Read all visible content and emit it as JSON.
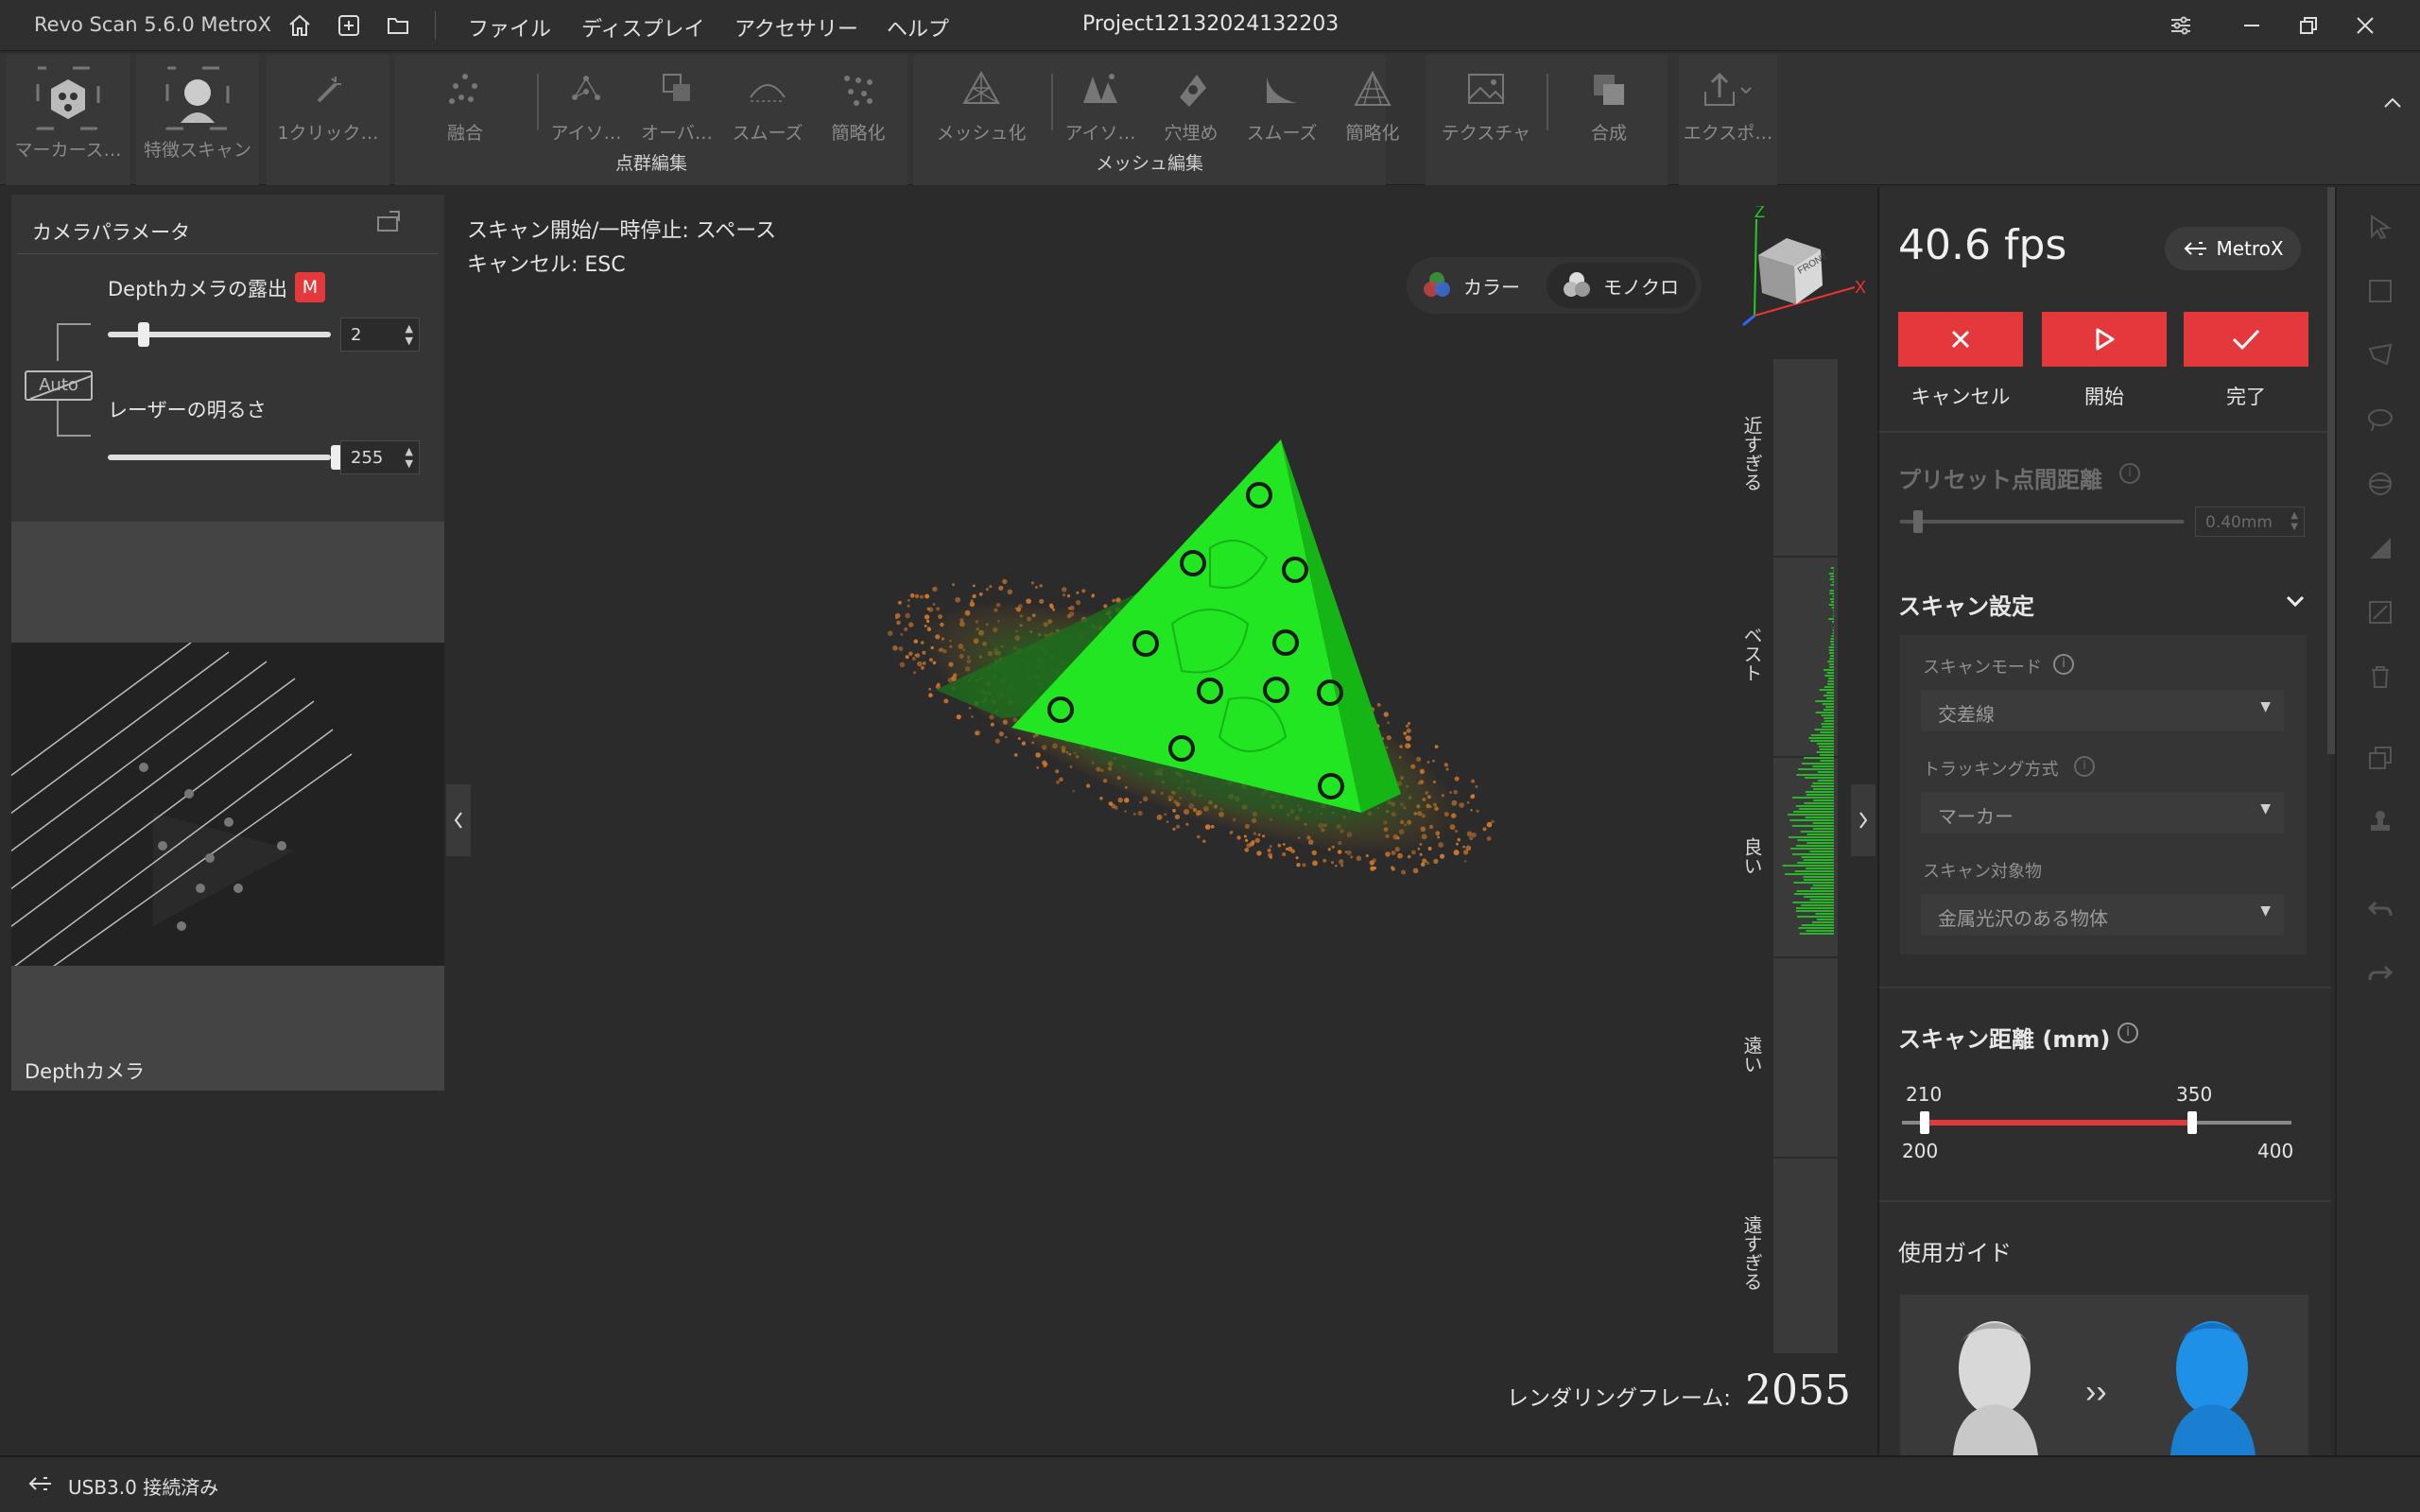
{
  "app": {
    "title": "Revo Scan 5.6.0 MetroX",
    "project": "Project12132024132203"
  },
  "menu": [
    "ファイル",
    "ディスプレイ",
    "アクセサリー",
    "ヘルプ"
  ],
  "toolbar": {
    "tools": [
      "マーカース…",
      "特徴スキャン",
      "1クリック…",
      "融合",
      "アイソ…",
      "オーバ…",
      "スムーズ",
      "簡略化",
      "メッシュ化",
      "アイソ…",
      "穴埋め",
      "スムーズ",
      "簡略化",
      "テクスチャ",
      "合成",
      "エクスポ…"
    ],
    "groups": {
      "point_cloud": "点群編集",
      "mesh": "メッシュ編集"
    }
  },
  "left_panel": {
    "title": "カメラパラメータ",
    "depth_exposure_label": "Depthカメラの露出",
    "mode_badge": "M",
    "depth_exposure_value": "2",
    "depth_exposure_level": 0.09,
    "auto_label": "Auto",
    "laser_label": "レーザーの明るさ",
    "laser_value": "255",
    "laser_level": 1.0,
    "camera_label": "Depthカメラ"
  },
  "viewport": {
    "hint_start": "スキャン開始/一時停止:  スペース",
    "hint_cancel": "キャンセル:  ESC",
    "color_mode": "カラー",
    "mono_mode": "モノクロ",
    "axis_z": "Z",
    "axis_x": "X",
    "cube_face": "FRONT",
    "quality_labels": [
      "近すぎる",
      "ベスト",
      "良い",
      "遠い",
      "遠すぎる"
    ],
    "render_label": "レンダリングフレーム:",
    "render_value": "2055"
  },
  "right_panel": {
    "fps": "40.6 fps",
    "device": "MetroX",
    "cancel": "キャンセル",
    "start": "開始",
    "done": "完了",
    "preset_label": "プリセット点間距離",
    "preset_value": "0.40mm",
    "scan_settings": "スキャン設定",
    "scan_mode_label": "スキャンモード",
    "scan_mode_value": "交差線",
    "tracking_label": "トラッキング方式",
    "tracking_value": "マーカー",
    "target_label": "スキャン対象物",
    "target_value": "金属光沢のある物体",
    "distance_title": "スキャン距離 (mm)",
    "distance_low": "210",
    "distance_high": "350",
    "distance_min": "200",
    "distance_max": "400",
    "guide_title": "使用ガイド"
  },
  "status": {
    "usb": "USB3.0 接続済み"
  },
  "colors": {
    "accent_red": "#e4393c",
    "green_mesh": "#22e622",
    "orange_points": "#d0782c"
  }
}
